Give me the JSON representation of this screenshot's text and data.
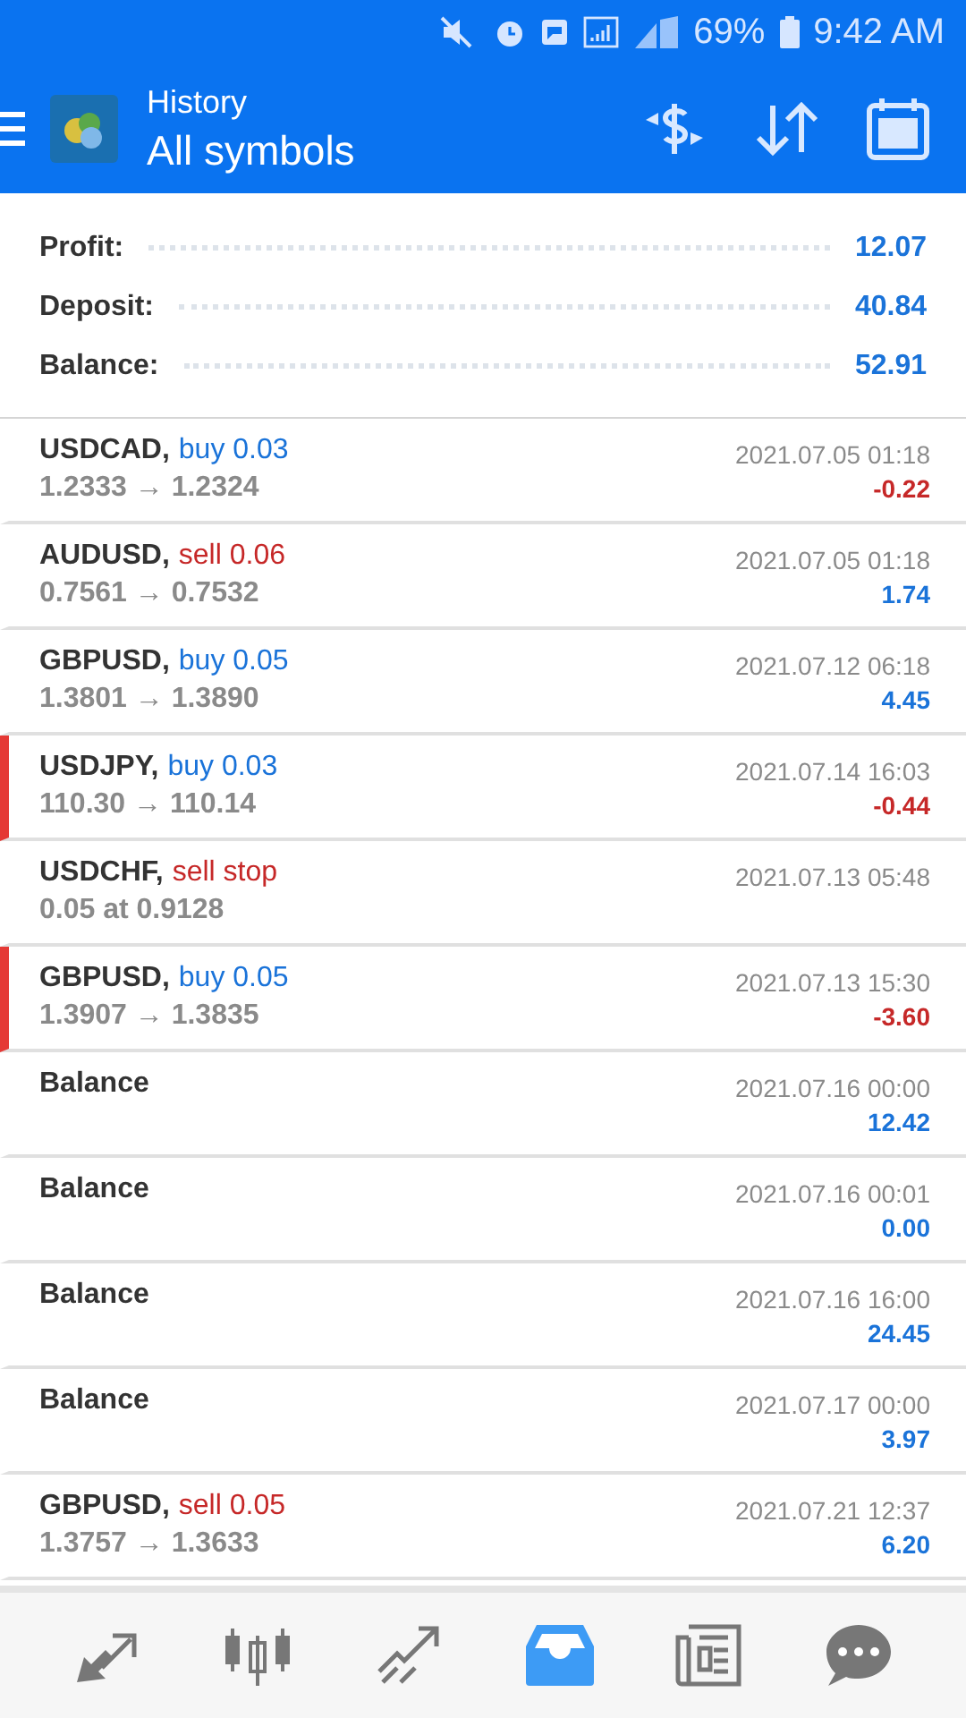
{
  "status_bar": {
    "battery": "69%",
    "time": "9:42 AM"
  },
  "header": {
    "title": "History",
    "subtitle": "All symbols"
  },
  "summary": [
    {
      "label": "Profit:",
      "value": "12.07"
    },
    {
      "label": "Deposit:",
      "value": "40.84"
    },
    {
      "label": "Balance:",
      "value": "52.91"
    }
  ],
  "rows": [
    {
      "kind": "trade",
      "symbol": "USDCAD,",
      "order": "buy 0.03",
      "sell": false,
      "detail": "1.2333 → 1.2324",
      "time": "2021.07.05 01:18",
      "amount": "-0.22",
      "loss": true,
      "marked": false
    },
    {
      "kind": "trade",
      "symbol": "AUDUSD,",
      "order": "sell 0.06",
      "sell": true,
      "detail": "0.7561 → 0.7532",
      "time": "2021.07.05 01:18",
      "amount": "1.74",
      "loss": false,
      "marked": false
    },
    {
      "kind": "trade",
      "symbol": "GBPUSD,",
      "order": "buy 0.05",
      "sell": false,
      "detail": "1.3801 → 1.3890",
      "time": "2021.07.12 06:18",
      "amount": "4.45",
      "loss": false,
      "marked": false
    },
    {
      "kind": "trade",
      "symbol": "USDJPY,",
      "order": "buy 0.03",
      "sell": false,
      "detail": "110.30 → 110.14",
      "time": "2021.07.14 16:03",
      "amount": "-0.44",
      "loss": true,
      "marked": true
    },
    {
      "kind": "order",
      "symbol": "USDCHF,",
      "order": "sell stop",
      "sell": true,
      "detail": "0.05 at 0.9128",
      "time": "2021.07.13 05:48",
      "marked": false
    },
    {
      "kind": "trade",
      "symbol": "GBPUSD,",
      "order": "buy 0.05",
      "sell": false,
      "detail": "1.3907 → 1.3835",
      "time": "2021.07.13 15:30",
      "amount": "-3.60",
      "loss": true,
      "marked": true
    },
    {
      "kind": "balance",
      "symbol": "Balance",
      "time": "2021.07.16 00:00",
      "amount": "12.42",
      "loss": false,
      "marked": false
    },
    {
      "kind": "balance",
      "symbol": "Balance",
      "time": "2021.07.16 00:01",
      "amount": "0.00",
      "loss": false,
      "marked": false
    },
    {
      "kind": "balance",
      "symbol": "Balance",
      "time": "2021.07.16 16:00",
      "amount": "24.45",
      "loss": false,
      "marked": false
    },
    {
      "kind": "balance",
      "symbol": "Balance",
      "time": "2021.07.17 00:00",
      "amount": "3.97",
      "loss": false,
      "marked": false
    },
    {
      "kind": "trade",
      "symbol": "GBPUSD,",
      "order": "sell 0.05",
      "sell": true,
      "detail": "1.3757 → 1.3633",
      "time": "2021.07.21 12:37",
      "amount": "6.20",
      "loss": false,
      "marked": false
    }
  ],
  "nav": [
    {
      "kind": "trade",
      "selected": false
    },
    {
      "kind": "chart",
      "selected": false
    },
    {
      "kind": "signals",
      "selected": false
    },
    {
      "kind": "history",
      "selected": true
    },
    {
      "kind": "news",
      "selected": false
    },
    {
      "kind": "chat",
      "selected": false
    }
  ]
}
